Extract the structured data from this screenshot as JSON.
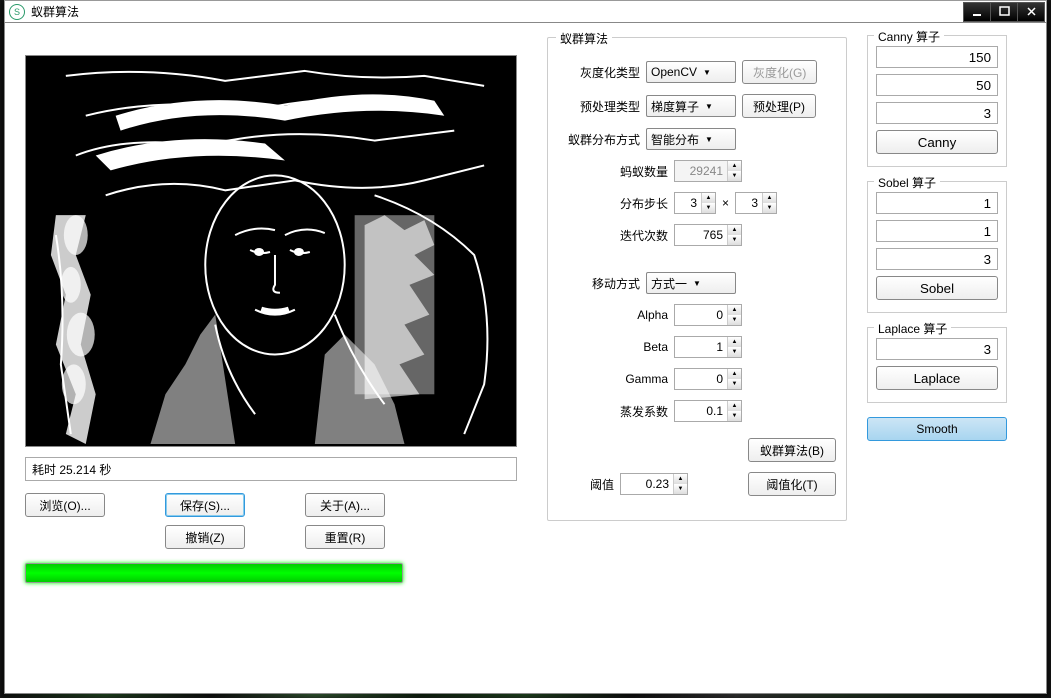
{
  "window": {
    "title": "蚁群算法"
  },
  "left": {
    "status": "耗时 25.214 秒",
    "browse": "浏览(O)...",
    "save": "保存(S)...",
    "about": "关于(A)...",
    "undo": "撤销(Z)",
    "reset": "重置(R)"
  },
  "ant": {
    "group_title": "蚁群算法",
    "gray_type_label": "灰度化类型",
    "gray_type_value": "OpenCV",
    "gray_button": "灰度化(G)",
    "preproc_type_label": "预处理类型",
    "preproc_type_value": "梯度算子",
    "preproc_button": "预处理(P)",
    "dist_label": "蚁群分布方式",
    "dist_value": "智能分布",
    "count_label": "蚂蚁数量",
    "count_value": "29241",
    "step_label": "分布步长",
    "step_x": "3",
    "step_y": "3",
    "iter_label": "迭代次数",
    "iter_value": "765",
    "move_label": "移动方式",
    "move_value": "方式一",
    "alpha_label": "Alpha",
    "alpha_value": "0",
    "beta_label": "Beta",
    "beta_value": "1",
    "gamma_label": "Gamma",
    "gamma_value": "0",
    "evap_label": "蒸发系数",
    "evap_value": "0.1",
    "run_button": "蚁群算法(B)",
    "thresh_label": "阈值",
    "thresh_value": "0.23",
    "thresh_button": "阈值化(T)"
  },
  "canny": {
    "title": "Canny 算子",
    "v1": "150",
    "v2": "50",
    "v3": "3",
    "btn": "Canny"
  },
  "sobel": {
    "title": "Sobel 算子",
    "v1": "1",
    "v2": "1",
    "v3": "3",
    "btn": "Sobel"
  },
  "laplace": {
    "title": "Laplace 算子",
    "v1": "3",
    "btn": "Laplace"
  },
  "smooth": {
    "btn": "Smooth"
  }
}
